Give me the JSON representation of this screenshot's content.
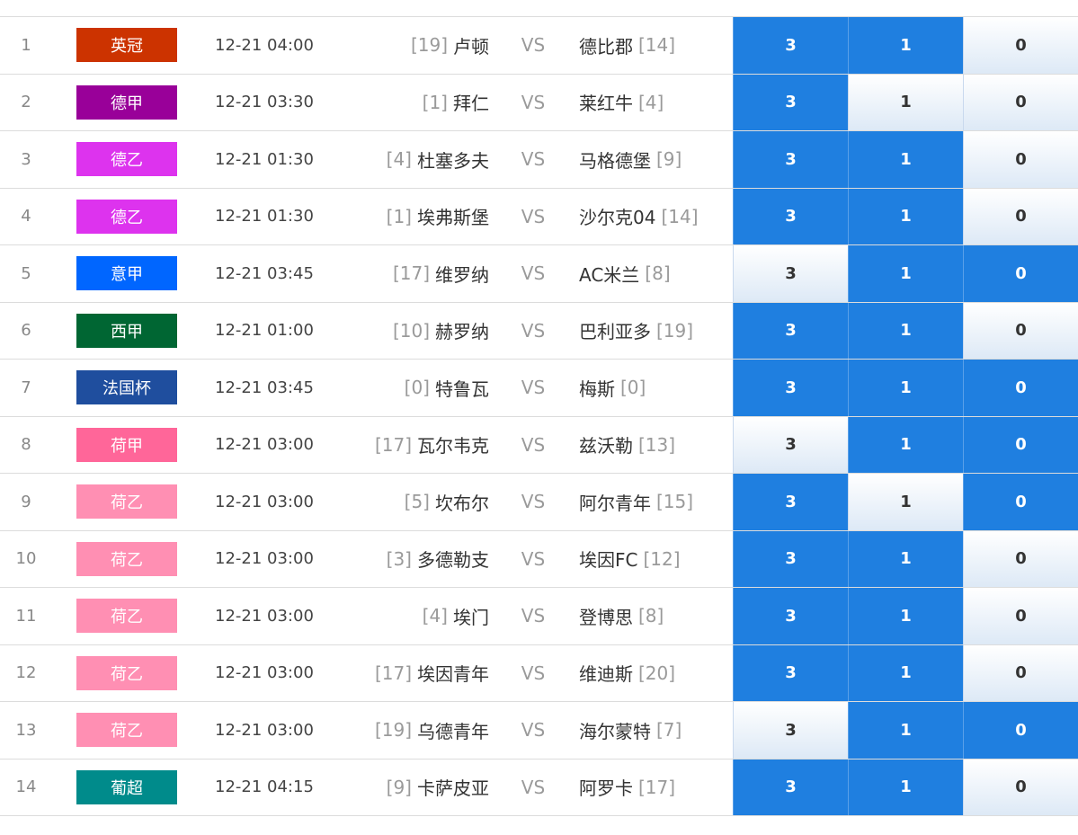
{
  "vs_label": "VS",
  "colors": {
    "selected_odd_bg": "#1f7fe0",
    "unselected_odd_bg": "#e6eef8"
  },
  "matches": [
    {
      "index": "1",
      "league": "英冠",
      "league_color": "#cc3300",
      "time": "12-21 04:00",
      "home_rank": "[19]",
      "home": "卢顿",
      "away": "德比郡",
      "away_rank": "[14]",
      "odds": [
        "3",
        "1",
        "0"
      ],
      "selected": [
        true,
        true,
        false
      ]
    },
    {
      "index": "2",
      "league": "德甲",
      "league_color": "#990099",
      "time": "12-21 03:30",
      "home_rank": "[1]",
      "home": "拜仁",
      "away": "莱红牛",
      "away_rank": "[4]",
      "odds": [
        "3",
        "1",
        "0"
      ],
      "selected": [
        true,
        false,
        false
      ]
    },
    {
      "index": "3",
      "league": "德乙",
      "league_color": "#dd33ee",
      "time": "12-21 01:30",
      "home_rank": "[4]",
      "home": "杜塞多夫",
      "away": "马格德堡",
      "away_rank": "[9]",
      "odds": [
        "3",
        "1",
        "0"
      ],
      "selected": [
        true,
        true,
        false
      ]
    },
    {
      "index": "4",
      "league": "德乙",
      "league_color": "#dd33ee",
      "time": "12-21 01:30",
      "home_rank": "[1]",
      "home": "埃弗斯堡",
      "away": "沙尔克04",
      "away_rank": "[14]",
      "odds": [
        "3",
        "1",
        "0"
      ],
      "selected": [
        true,
        true,
        false
      ]
    },
    {
      "index": "5",
      "league": "意甲",
      "league_color": "#0066ff",
      "time": "12-21 03:45",
      "home_rank": "[17]",
      "home": "维罗纳",
      "away": "AC米兰",
      "away_rank": "[8]",
      "odds": [
        "3",
        "1",
        "0"
      ],
      "selected": [
        false,
        true,
        true
      ]
    },
    {
      "index": "6",
      "league": "西甲",
      "league_color": "#006633",
      "time": "12-21 01:00",
      "home_rank": "[10]",
      "home": "赫罗纳",
      "away": "巴利亚多",
      "away_rank": "[19]",
      "odds": [
        "3",
        "1",
        "0"
      ],
      "selected": [
        true,
        true,
        false
      ]
    },
    {
      "index": "7",
      "league": "法国杯",
      "league_color": "#1f4e9e",
      "time": "12-21 03:45",
      "home_rank": "[0]",
      "home": "特鲁瓦",
      "away": "梅斯",
      "away_rank": "[0]",
      "odds": [
        "3",
        "1",
        "0"
      ],
      "selected": [
        true,
        true,
        true
      ]
    },
    {
      "index": "8",
      "league": "荷甲",
      "league_color": "#ff6699",
      "time": "12-21 03:00",
      "home_rank": "[17]",
      "home": "瓦尔韦克",
      "away": "兹沃勒",
      "away_rank": "[13]",
      "odds": [
        "3",
        "1",
        "0"
      ],
      "selected": [
        false,
        true,
        true
      ]
    },
    {
      "index": "9",
      "league": "荷乙",
      "league_color": "#ff8fb3",
      "time": "12-21 03:00",
      "home_rank": "[5]",
      "home": "坎布尔",
      "away": "阿尔青年",
      "away_rank": "[15]",
      "odds": [
        "3",
        "1",
        "0"
      ],
      "selected": [
        true,
        false,
        true
      ]
    },
    {
      "index": "10",
      "league": "荷乙",
      "league_color": "#ff8fb3",
      "time": "12-21 03:00",
      "home_rank": "[3]",
      "home": "多德勒支",
      "away": "埃因FC",
      "away_rank": "[12]",
      "odds": [
        "3",
        "1",
        "0"
      ],
      "selected": [
        true,
        true,
        false
      ]
    },
    {
      "index": "11",
      "league": "荷乙",
      "league_color": "#ff8fb3",
      "time": "12-21 03:00",
      "home_rank": "[4]",
      "home": "埃门",
      "away": "登博思",
      "away_rank": "[8]",
      "odds": [
        "3",
        "1",
        "0"
      ],
      "selected": [
        true,
        true,
        false
      ]
    },
    {
      "index": "12",
      "league": "荷乙",
      "league_color": "#ff8fb3",
      "time": "12-21 03:00",
      "home_rank": "[17]",
      "home": "埃因青年",
      "away": "维迪斯",
      "away_rank": "[20]",
      "odds": [
        "3",
        "1",
        "0"
      ],
      "selected": [
        true,
        true,
        false
      ]
    },
    {
      "index": "13",
      "league": "荷乙",
      "league_color": "#ff8fb3",
      "time": "12-21 03:00",
      "home_rank": "[19]",
      "home": "乌德青年",
      "away": "海尔蒙特",
      "away_rank": "[7]",
      "odds": [
        "3",
        "1",
        "0"
      ],
      "selected": [
        false,
        true,
        true
      ]
    },
    {
      "index": "14",
      "league": "葡超",
      "league_color": "#008b8b",
      "time": "12-21 04:15",
      "home_rank": "[9]",
      "home": "卡萨皮亚",
      "away": "阿罗卡",
      "away_rank": "[17]",
      "odds": [
        "3",
        "1",
        "0"
      ],
      "selected": [
        true,
        true,
        false
      ]
    }
  ]
}
